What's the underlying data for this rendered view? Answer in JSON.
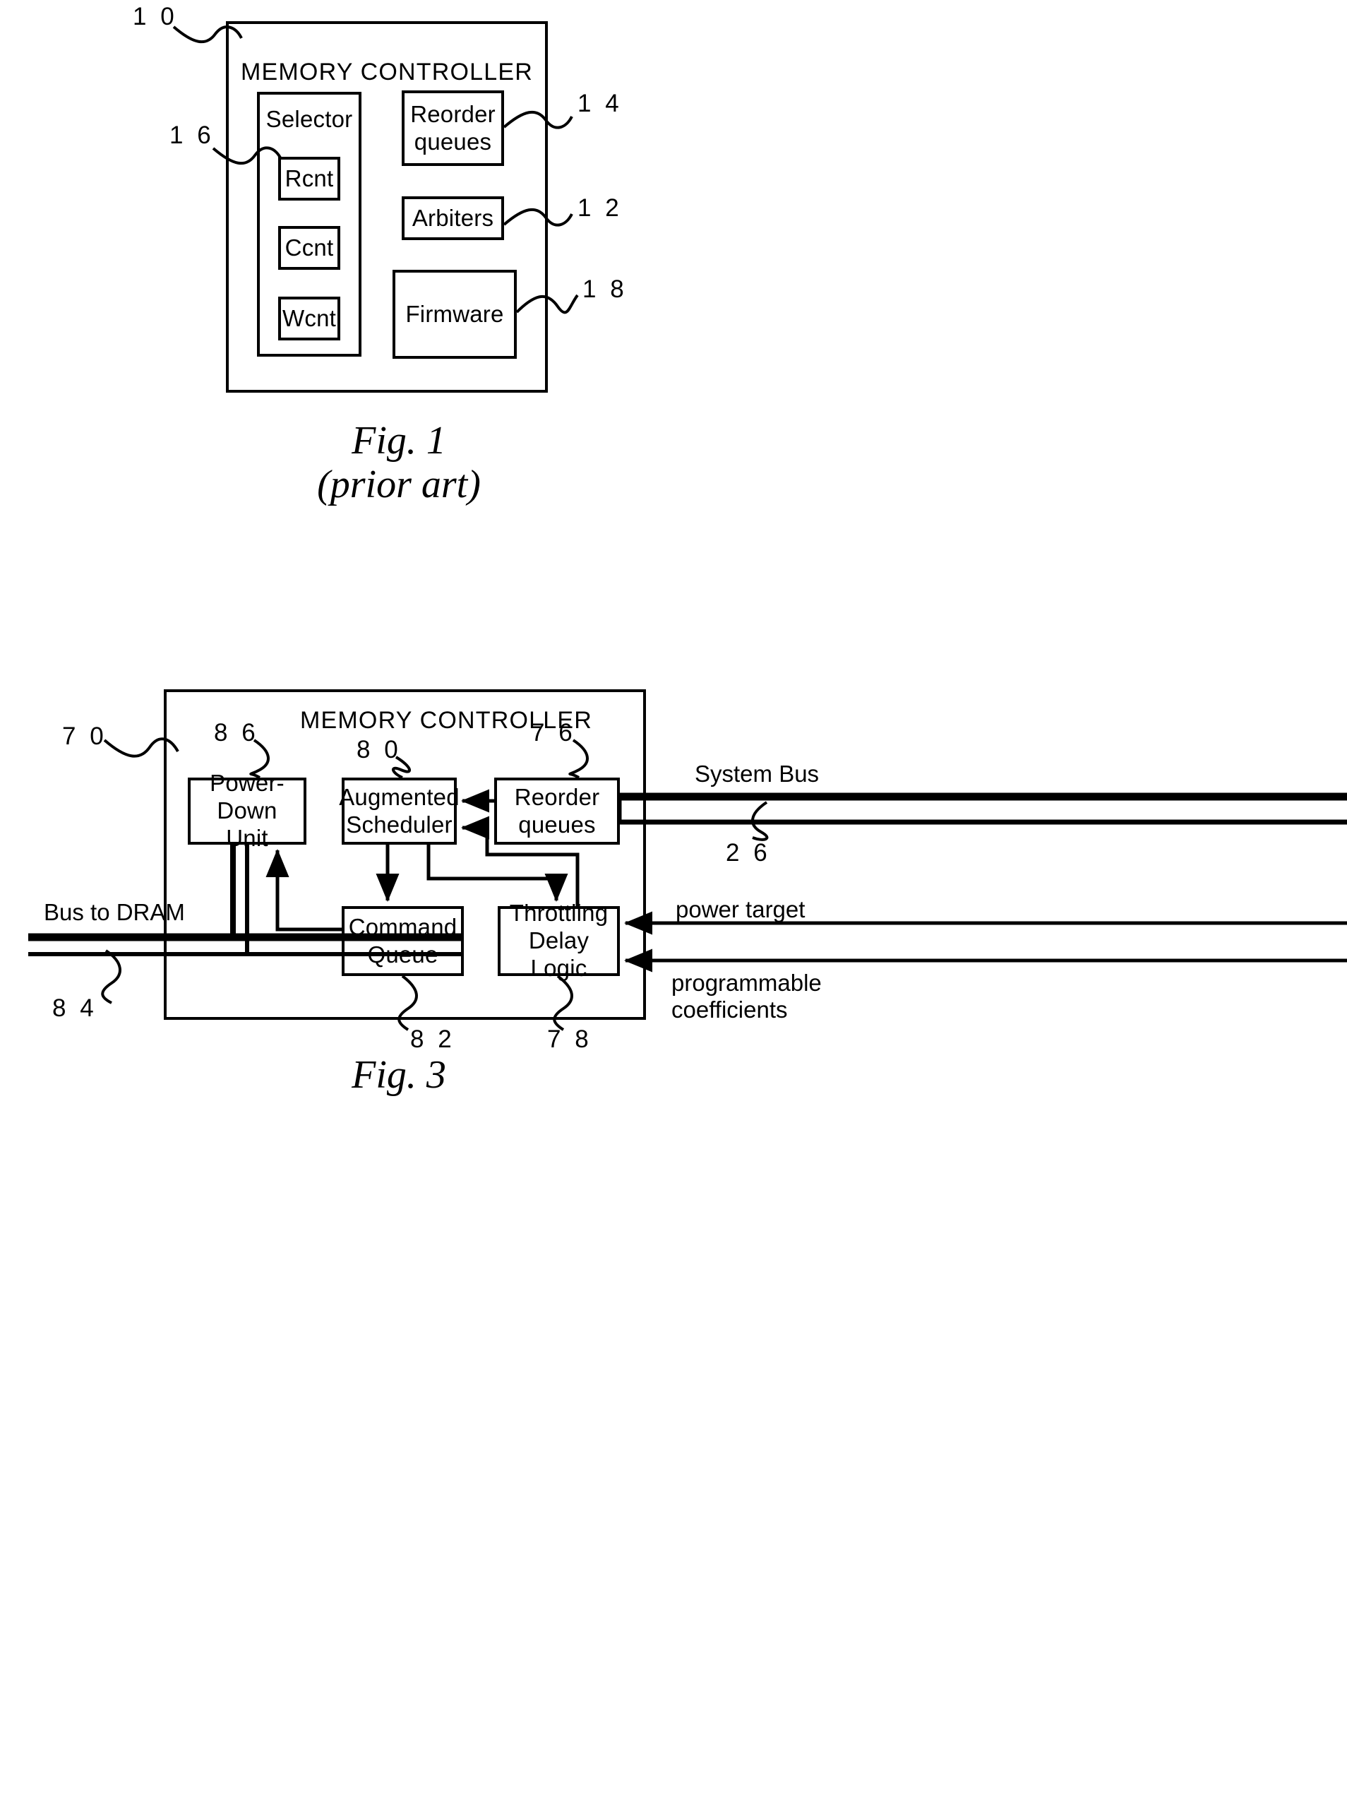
{
  "document": {
    "type": "patent-drawing-sheet",
    "figures": [
      {
        "id": "fig1",
        "caption_line1": "Fig. 1",
        "caption_line2": "(prior art)",
        "outer_box": {
          "title": "MEMORY CONTROLLER",
          "ref": "1 0"
        },
        "blocks": [
          {
            "key": "selector",
            "label": "Selector",
            "ref": "1 6"
          },
          {
            "key": "rcnt",
            "label": "Rcnt",
            "ref": ""
          },
          {
            "key": "ccnt",
            "label": "Ccnt",
            "ref": ""
          },
          {
            "key": "wcnt",
            "label": "Wcnt",
            "ref": ""
          },
          {
            "key": "reorder_queues",
            "label_line1": "Reorder",
            "label_line2": "queues",
            "ref": "1 4"
          },
          {
            "key": "arbiters",
            "label": "Arbiters",
            "ref": "1 2"
          },
          {
            "key": "firmware",
            "label": "Firmware",
            "ref": "1 8"
          }
        ]
      },
      {
        "id": "fig3",
        "caption_line1": "Fig. 3",
        "outer_box": {
          "title": "MEMORY CONTROLLER",
          "ref": "7 0"
        },
        "blocks": [
          {
            "key": "power_down_unit",
            "label_line1": "Power-Down",
            "label_line2": "Unit",
            "ref": "8 6"
          },
          {
            "key": "augmented_scheduler",
            "label_line1": "Augmented",
            "label_line2": "Scheduler",
            "ref": "8 0"
          },
          {
            "key": "reorder_queues",
            "label_line1": "Reorder",
            "label_line2": "queues",
            "ref": "7 6"
          },
          {
            "key": "command_queue",
            "label_line1": "Command",
            "label_line2": "Queue",
            "ref": "8 2"
          },
          {
            "key": "throttling_logic",
            "label_line1": "Throttling",
            "label_line2": "Delay Logic",
            "ref": "7 8"
          }
        ],
        "external_labels": [
          {
            "key": "system_bus",
            "label": "System Bus",
            "ref": "2 6"
          },
          {
            "key": "bus_to_dram",
            "label": "Bus to DRAM",
            "ref": "8 4"
          },
          {
            "key": "power_target",
            "label": "power target",
            "ref": ""
          },
          {
            "key": "prog_coeff_l1",
            "label": "programmable",
            "ref": ""
          },
          {
            "key": "prog_coeff_l2",
            "label": "coefficients",
            "ref": ""
          }
        ]
      }
    ]
  },
  "colors": {
    "ink": "#000000",
    "paper": "#ffffff"
  }
}
